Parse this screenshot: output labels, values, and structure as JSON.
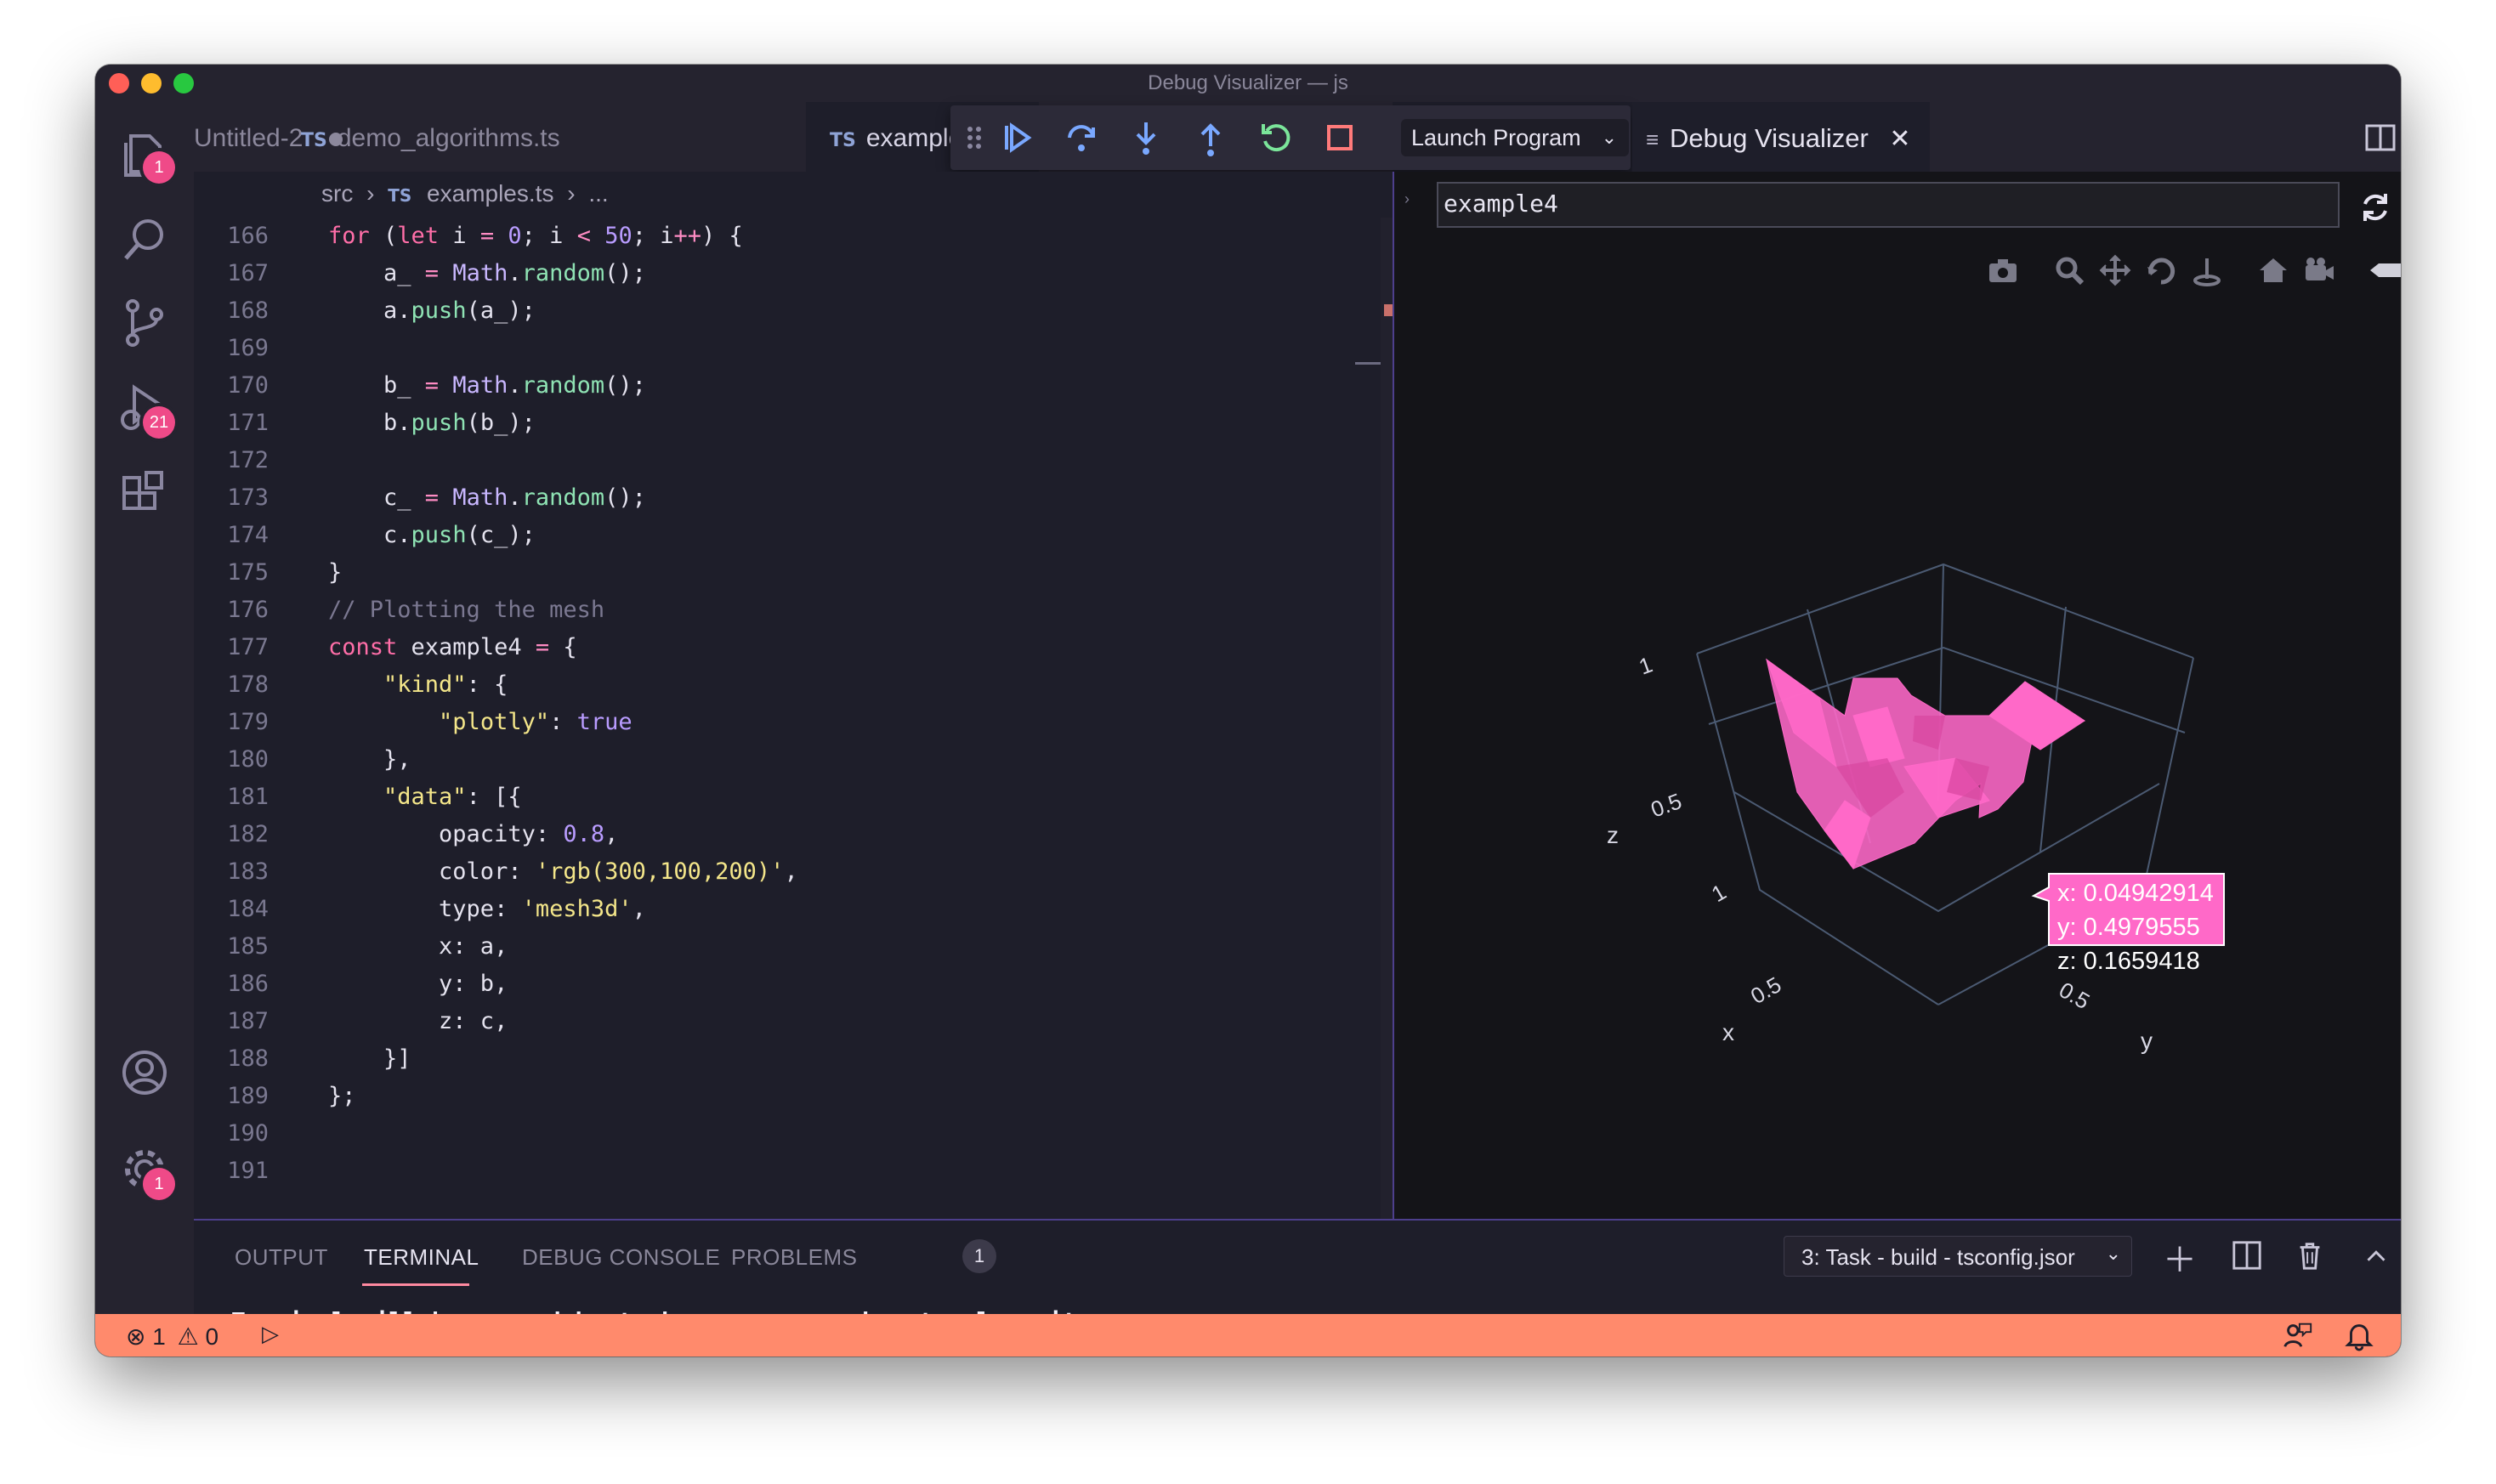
{
  "window": {
    "title": "Debug Visualizer — js"
  },
  "activity": {
    "explorer_badge": "1",
    "debug_badge": "21",
    "settings_badge": "1"
  },
  "tabs": [
    {
      "label": "Untitled-2"
    },
    {
      "label": "demo_algorithms.ts",
      "lang": "TS"
    },
    {
      "label": "examples.ts",
      "lang": "TS"
    }
  ],
  "debug_toolbar": {
    "config": "Launch Program"
  },
  "visualizer_tab": {
    "label": "Debug Visualizer"
  },
  "breadcrumb": {
    "folder": "src",
    "lang": "TS",
    "file": "examples.ts",
    "more": "..."
  },
  "editor": {
    "line_numbers": [
      "166",
      "167",
      "168",
      "169",
      "170",
      "171",
      "172",
      "173",
      "174",
      "175",
      "176",
      "177",
      "178",
      "179",
      "180",
      "181",
      "182",
      "183",
      "184",
      "185",
      "186",
      "187",
      "188",
      "189",
      "190",
      "191"
    ]
  },
  "visualizer": {
    "expression": "example4",
    "axes": {
      "x": "x",
      "y": "y",
      "z": "z"
    },
    "ticks": {
      "z_1": "1",
      "z_05": "0.5",
      "x_1": "1",
      "x_05": "0.5",
      "y_05": "0.5"
    },
    "tooltip": {
      "x": "x: 0.04942914",
      "y": "y: 0.4979555",
      "z": "z: 0.1659418"
    },
    "mesh_color": "#ff69c8"
  },
  "panel": {
    "tabs": {
      "output": "OUTPUT",
      "terminal": "TERMINAL",
      "debug_console": "DEBUG CONSOLE",
      "problems": "PROBLEMS"
    },
    "problems_count": "1",
    "task_select": "3: Task - build - tsconfig.jsor",
    "terminal_text": "Terminal will be reused by tasks, press any key to close it."
  },
  "status": {
    "errors": "1",
    "warnings": "0"
  },
  "colors": {
    "accent": "#4d3f8c",
    "status_bar": "#ff8a6c",
    "badge": "#ef4a88"
  }
}
